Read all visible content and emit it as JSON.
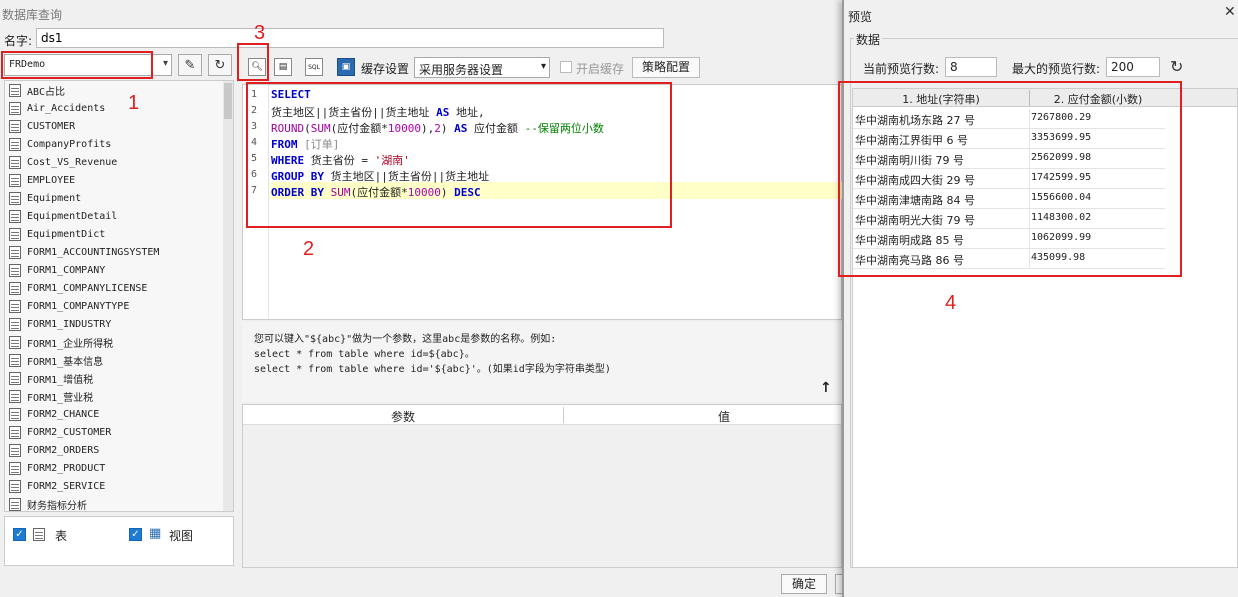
{
  "window": {
    "title": "数据库查询",
    "name_label": "名字:",
    "name_value": "ds1"
  },
  "left": {
    "db_select": "FRDemo",
    "tables": [
      "ABC占比",
      "Air_Accidents",
      "CUSTOMER",
      "CompanyProfits",
      "Cost_VS_Revenue",
      "EMPLOYEE",
      "Equipment",
      "EquipmentDetail",
      "EquipmentDict",
      "FORM1_ACCOUNTINGSYSTEM",
      "FORM1_COMPANY",
      "FORM1_COMPANYLICENSE",
      "FORM1_COMPANYTYPE",
      "FORM1_INDUSTRY",
      "FORM1_企业所得税",
      "FORM1_基本信息",
      "FORM1_增值税",
      "FORM1_营业税",
      "FORM2_CHANCE",
      "FORM2_CUSTOMER",
      "FORM2_ORDERS",
      "FORM2_PRODUCT",
      "FORM2_SERVICE",
      "财务指标分析"
    ],
    "filter_table_label": "表",
    "filter_view_label": "视图"
  },
  "toolbar": {
    "cache_label": "缓存设置",
    "cache_select": "采用服务器设置",
    "enable_cache_label": "开启缓存",
    "strategy_label": "策略配置"
  },
  "editor": {
    "line_numbers": [
      "1",
      "2",
      "3",
      "4",
      "5",
      "6",
      "7"
    ]
  },
  "hint": {
    "line1": "您可以键入\"${abc}\"做为一个参数，这里abc是参数的名称。例如:",
    "line2": "select * from table where id=${abc}。",
    "line3": "select * from table where id='${abc}'。(如果id字段为字符串类型)"
  },
  "params": {
    "col_param": "参数",
    "col_value": "值"
  },
  "buttons": {
    "ok": "确定"
  },
  "preview": {
    "title": "预览",
    "group_label": "数据",
    "current_rows_label": "当前预览行数:",
    "current_rows": "8",
    "max_rows_label": "最大的预览行数:",
    "max_rows": "200",
    "columns": [
      "1. 地址(字符串)",
      "2. 应付金额(小数)"
    ],
    "rows": [
      [
        "华中湖南机场东路 27 号",
        "7267800.29"
      ],
      [
        "华中湖南江界街甲 6 号",
        "3353699.95"
      ],
      [
        "华中湖南明川街 79 号",
        "2562099.98"
      ],
      [
        "华中湖南成四大街 29 号",
        "1742599.95"
      ],
      [
        "华中湖南津塘南路 84 号",
        "1556600.04"
      ],
      [
        "华中湖南明光大街 79 号",
        "1148300.02"
      ],
      [
        "华中湖南明成路 85 号",
        "1062099.99"
      ],
      [
        "华中湖南亮马路 86 号",
        "435099.98"
      ]
    ]
  },
  "annotations": [
    "1",
    "2",
    "3",
    "4"
  ],
  "colors": {
    "annotation_red": "#e02020",
    "keyword_blue": "#0000cc",
    "highlight_line": "#ffffc8"
  }
}
